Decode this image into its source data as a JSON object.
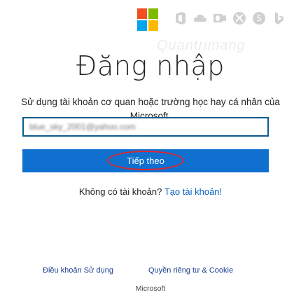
{
  "header": {
    "logo_name": "microsoft-logo",
    "logo_colors": [
      "#f25022",
      "#7fba00",
      "#00a4ef",
      "#ffb900"
    ],
    "service_icons": [
      "office-icon",
      "onedrive-icon",
      "outlook-icon",
      "xbox-icon",
      "skype-icon",
      "bing-icon"
    ]
  },
  "watermark": {
    "text": "Quantrimang"
  },
  "main": {
    "title": "Đăng nhập",
    "subtitle": "Sử dụng tài khoản cơ quan hoặc trường học hay cá nhân của Microsoft.",
    "email_value": "blue_sky_2001@yahoo.com",
    "next_label": "Tiếp theo",
    "no_account_text": "Không có tài khoản?",
    "create_account_link": "Tạo tài khoản!"
  },
  "footer": {
    "terms_label": "Điều khoản Sử dụng",
    "privacy_label": "Quyền riêng tư & Cookie",
    "brand": "Microsoft"
  },
  "colors": {
    "accent": "#0f70cf",
    "field_border": "#0f5c8c",
    "link": "#0b63c1",
    "highlight": "#e1262d"
  }
}
